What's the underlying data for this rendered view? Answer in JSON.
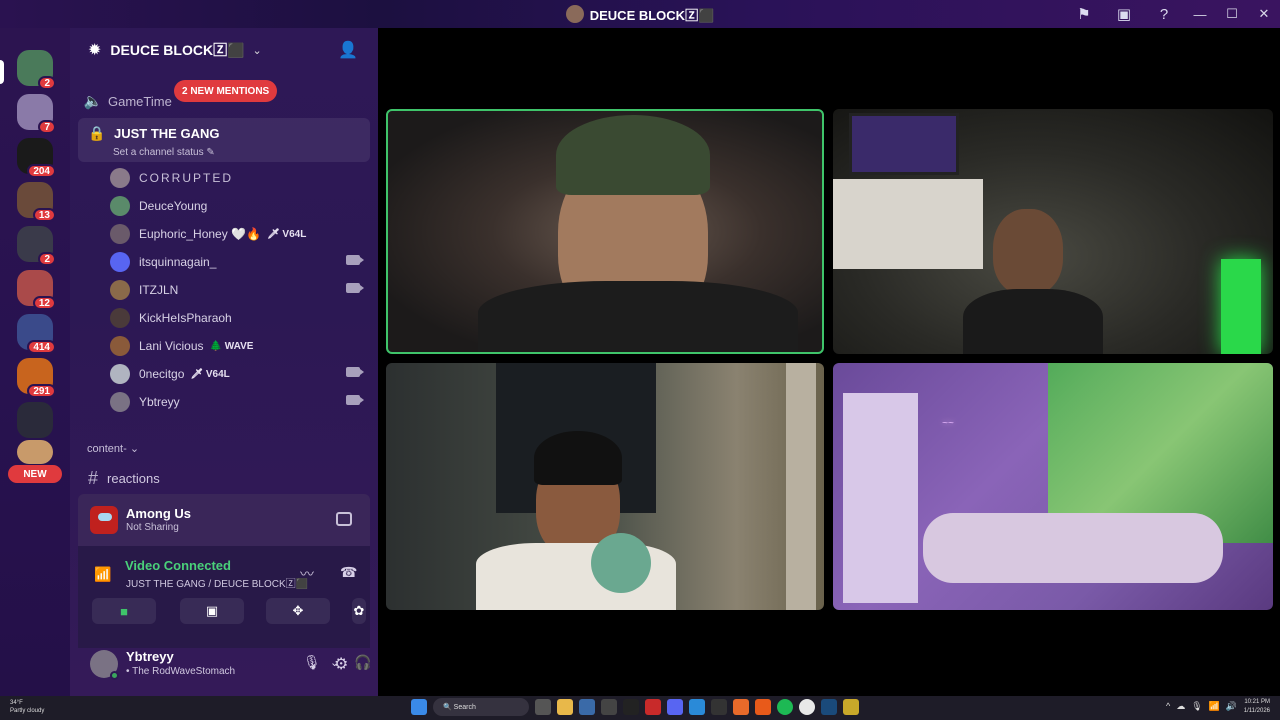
{
  "window": {
    "title": "DEUCE BLOCK🅉⬛"
  },
  "titlebar_icons": [
    "flag-icon",
    "screen-share-icon",
    "help-icon"
  ],
  "window_controls": {
    "minimize": "—",
    "maximize": "☐",
    "close": "✕"
  },
  "server_rail": {
    "badges": [
      "2",
      "7",
      "204",
      "13",
      "2",
      "12",
      "414",
      "291"
    ],
    "new_label": "NEW",
    "colors": [
      "#4a7a5a",
      "#8a7aa8",
      "#1a1a1a",
      "#6a4a3a",
      "#3a3a4a",
      "#aa4a4a",
      "#3a4a8a",
      "#c8641e",
      "#2a2a3a",
      "#c89a6a"
    ]
  },
  "server": {
    "name": "DEUCE BLOCK🅉⬛",
    "invite_icon": "add-user-icon"
  },
  "mentions_label": "2 NEW MENTIONS",
  "channels": {
    "gametime": "GameTime",
    "voice_channel": {
      "name": "JUST THE GANG",
      "status": "Set a channel status"
    }
  },
  "members": [
    {
      "name": "CORRUPTED",
      "tag": "",
      "camera": false,
      "color": "#8a7a8a"
    },
    {
      "name": "DeuceYoung",
      "tag": "",
      "camera": false,
      "color": "#5a8a6a"
    },
    {
      "name": "Euphoric_Honey 🤍🔥",
      "tag": "🗡 V64L",
      "camera": false,
      "color": "#6a5a6a"
    },
    {
      "name": "itsquinnagain_",
      "tag": "",
      "camera": true,
      "color": "#5865f2"
    },
    {
      "name": "ITZJLN",
      "tag": "",
      "camera": true,
      "color": "#8a6a4a"
    },
    {
      "name": "KickHeIsPharaoh",
      "tag": "",
      "camera": false,
      "color": "#4a3a3a"
    },
    {
      "name": "Lani Vicious",
      "tag": "🌲 WAVE",
      "camera": false,
      "color": "#8a5a3a"
    },
    {
      "name": "0necitgo",
      "tag": "🗡 V64L",
      "camera": true,
      "color": "#b0b4c0"
    },
    {
      "name": "Ybtreyy",
      "tag": "",
      "camera": true,
      "color": "#7a7284"
    }
  ],
  "category": "content-",
  "text_channel": "reactions",
  "activity": {
    "game": "Among Us",
    "status": "Not Sharing"
  },
  "voice_connection": {
    "title": "Video Connected",
    "subtitle": "JUST THE GANG / DEUCE BLOCK🅉⬛",
    "buttons": [
      "camera-icon",
      "share-screen-icon",
      "activities-icon",
      "soundboard-icon"
    ]
  },
  "user": {
    "name": "Ybtreyy",
    "status": "• The RodWaveStomach"
  },
  "taskbar": {
    "weather_temp": "34°F",
    "weather_desc": "Partly cloudy",
    "search_label": "Search",
    "time": "10:21 PM",
    "date": "1/11/2026"
  }
}
